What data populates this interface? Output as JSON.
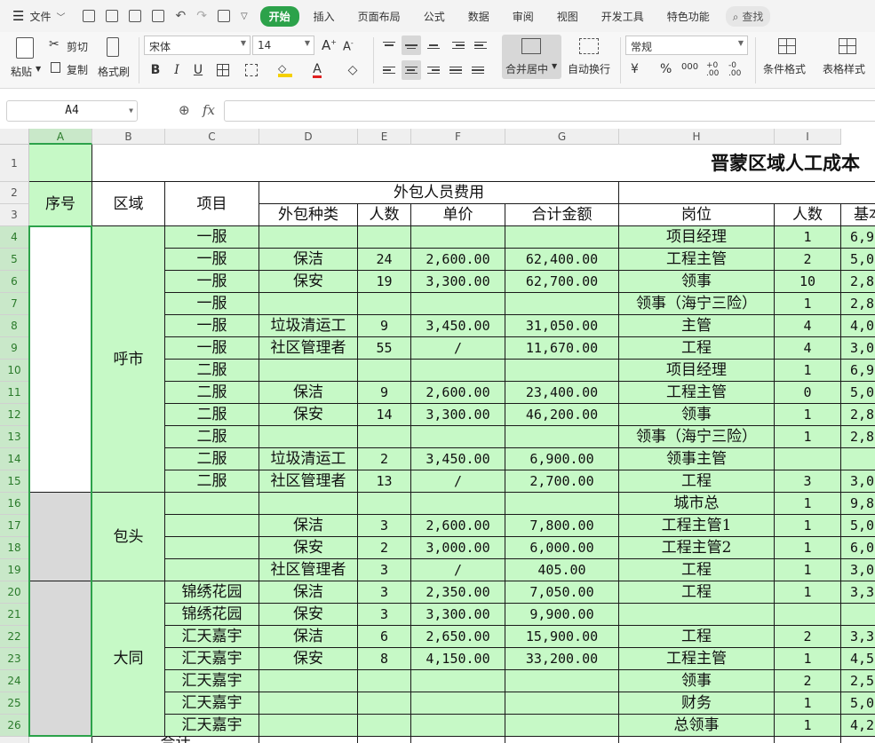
{
  "menubar": {
    "file_label": "文件",
    "tabs": [
      "开始",
      "插入",
      "页面布局",
      "公式",
      "数据",
      "审阅",
      "视图",
      "开发工具",
      "特色功能"
    ],
    "search_label": "查找"
  },
  "ribbon": {
    "paste": "粘贴",
    "cut": "剪切",
    "copy": "复制",
    "format_painter": "格式刷",
    "font_name": "宋体",
    "font_size": "14",
    "bold": "B",
    "italic": "I",
    "underline": "U",
    "merge_center": "合并居中",
    "wrap_text": "自动换行",
    "number_format": "常规",
    "currency": "¥",
    "percent": "%",
    "thousands": "000",
    "inc_decimal": "+0 .00",
    "dec_decimal": "-0 .00",
    "conditional_format": "条件格式",
    "table_style": "表格样式"
  },
  "formula_bar": {
    "cell_ref": "A4",
    "fx": "fx",
    "value": ""
  },
  "sheet": {
    "columns": [
      "A",
      "B",
      "C",
      "D",
      "E",
      "F",
      "G",
      "H",
      "I"
    ],
    "selected_column": "A",
    "selected_rows_from": 4,
    "selected_rows_to": 26,
    "title": "晋蒙区域人工成本",
    "header": {
      "seq": "序号",
      "region": "区域",
      "project": "项目",
      "outsource_group": "外包人员费用",
      "outsource_type": "外包种类",
      "headcount": "人数",
      "unit_price": "单价",
      "total": "合计金额",
      "post": "岗位",
      "post_count": "人数",
      "base_partial": "基本"
    },
    "regions": [
      {
        "name": "呼市",
        "from": 4,
        "to": 15
      },
      {
        "name": "包头",
        "from": 16,
        "to": 19
      },
      {
        "name": "大同",
        "from": 20,
        "to": 26
      }
    ],
    "rows": [
      {
        "n": 4,
        "project": "一服",
        "type": "",
        "count": "",
        "price": "",
        "total": "",
        "post": "项目经理",
        "pcount": "1",
        "base": "6,9"
      },
      {
        "n": 5,
        "project": "一服",
        "type": "保洁",
        "count": "24",
        "price": "2,600.00",
        "total": "62,400.00",
        "post": "工程主管",
        "pcount": "2",
        "base": "5,0"
      },
      {
        "n": 6,
        "project": "一服",
        "type": "保安",
        "count": "19",
        "price": "3,300.00",
        "total": "62,700.00",
        "post": "领事",
        "pcount": "10",
        "base": "2,8"
      },
      {
        "n": 7,
        "project": "一服",
        "type": "",
        "count": "",
        "price": "",
        "total": "",
        "post": "领事（海宁三险）",
        "pcount": "1",
        "base": "2,8"
      },
      {
        "n": 8,
        "project": "一服",
        "type": "垃圾清运工",
        "count": "9",
        "price": "3,450.00",
        "total": "31,050.00",
        "post": "主管",
        "pcount": "4",
        "base": "4,0"
      },
      {
        "n": 9,
        "project": "一服",
        "type": "社区管理者",
        "count": "55",
        "price": "/",
        "total": "11,670.00",
        "post": "工程",
        "pcount": "4",
        "base": "3,0"
      },
      {
        "n": 10,
        "project": "二服",
        "type": "",
        "count": "",
        "price": "",
        "total": "",
        "post": "项目经理",
        "pcount": "1",
        "base": "6,9"
      },
      {
        "n": 11,
        "project": "二服",
        "type": "保洁",
        "count": "9",
        "price": "2,600.00",
        "total": "23,400.00",
        "post": "工程主管",
        "pcount": "0",
        "base": "5,0"
      },
      {
        "n": 12,
        "project": "二服",
        "type": "保安",
        "count": "14",
        "price": "3,300.00",
        "total": "46,200.00",
        "post": "领事",
        "pcount": "1",
        "base": "2,8"
      },
      {
        "n": 13,
        "project": "二服",
        "type": "",
        "count": "",
        "price": "",
        "total": "",
        "post": "领事（海宁三险）",
        "pcount": "1",
        "base": "2,8"
      },
      {
        "n": 14,
        "project": "二服",
        "type": "垃圾清运工",
        "count": "2",
        "price": "3,450.00",
        "total": "6,900.00",
        "post": "领事主管",
        "pcount": "",
        "base": ""
      },
      {
        "n": 15,
        "project": "二服",
        "type": "社区管理者",
        "count": "13",
        "price": "/",
        "total": "2,700.00",
        "post": "工程",
        "pcount": "3",
        "base": "3,0"
      },
      {
        "n": 16,
        "project": "",
        "type": "",
        "count": "",
        "price": "",
        "total": "",
        "post": "城市总",
        "pcount": "1",
        "base": "9,8"
      },
      {
        "n": 17,
        "project": "",
        "type": "保洁",
        "count": "3",
        "price": "2,600.00",
        "total": "7,800.00",
        "post": "工程主管1",
        "pcount": "1",
        "base": "5,0"
      },
      {
        "n": 18,
        "project": "",
        "type": "保安",
        "count": "2",
        "price": "3,000.00",
        "total": "6,000.00",
        "post": "工程主管2",
        "pcount": "1",
        "base": "6,0"
      },
      {
        "n": 19,
        "project": "",
        "type": "社区管理者",
        "count": "3",
        "price": "/",
        "total": "405.00",
        "post": "工程",
        "pcount": "1",
        "base": "3,0"
      },
      {
        "n": 20,
        "project": "锦绣花园",
        "type": "保洁",
        "count": "3",
        "price": "2,350.00",
        "total": "7,050.00",
        "post": "工程",
        "pcount": "1",
        "base": "3,3"
      },
      {
        "n": 21,
        "project": "锦绣花园",
        "type": "保安",
        "count": "3",
        "price": "3,300.00",
        "total": "9,900.00",
        "post": "",
        "pcount": "",
        "base": ""
      },
      {
        "n": 22,
        "project": "汇天嘉宇",
        "type": "保洁",
        "count": "6",
        "price": "2,650.00",
        "total": "15,900.00",
        "post": "工程",
        "pcount": "2",
        "base": "3,3"
      },
      {
        "n": 23,
        "project": "汇天嘉宇",
        "type": "保安",
        "count": "8",
        "price": "4,150.00",
        "total": "33,200.00",
        "post": "工程主管",
        "pcount": "1",
        "base": "4,5"
      },
      {
        "n": 24,
        "project": "汇天嘉宇",
        "type": "",
        "count": "",
        "price": "",
        "total": "",
        "post": "领事",
        "pcount": "2",
        "base": "2,5"
      },
      {
        "n": 25,
        "project": "汇天嘉宇",
        "type": "",
        "count": "",
        "price": "",
        "total": "",
        "post": "财务",
        "pcount": "1",
        "base": "5,0"
      },
      {
        "n": 26,
        "project": "汇天嘉宇",
        "type": "",
        "count": "",
        "price": "",
        "total": "",
        "post": "总领事",
        "pcount": "1",
        "base": "4,2"
      }
    ],
    "footer_partial": "合计"
  }
}
